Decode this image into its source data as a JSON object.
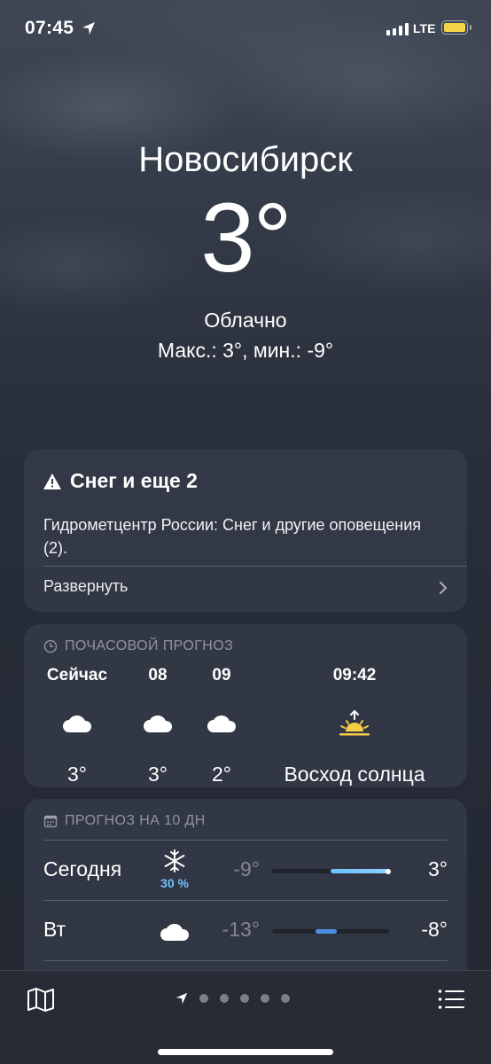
{
  "status_bar": {
    "time": "07:45",
    "network": "LTE",
    "battery_color": "#f5d547"
  },
  "header": {
    "city": "Новосибирск",
    "temperature": "3°",
    "condition": "Облачно",
    "minmax": "Макс.: 3°, мин.: -9°"
  },
  "alert": {
    "title": "Снег и еще 2",
    "body": "Гидрометцентр России: Снег и другие оповещения (2).",
    "expand_label": "Развернуть",
    "icon": "warning-triangle-icon"
  },
  "hourly": {
    "section_label": "ПОЧАСОВОЙ ПРОГНОЗ",
    "items": [
      {
        "time": "Сейчас",
        "icon": "cloud-icon",
        "temp": "3°"
      },
      {
        "time": "08",
        "icon": "cloud-icon",
        "temp": "3°"
      },
      {
        "time": "09",
        "icon": "cloud-icon",
        "temp": "2°"
      },
      {
        "time": "09:42",
        "icon": "sunrise-icon",
        "temp": "Восход солнца"
      }
    ]
  },
  "daily": {
    "section_label": "ПРОГНОЗ НА 10 ДН",
    "days": [
      {
        "day": "Сегодня",
        "icon": "snowflake-icon",
        "precip": "30 %",
        "low": "-9°",
        "high": "3°",
        "range_start_fraction": 0.5,
        "range_end_fraction": 1.0,
        "current_fraction": 0.99
      },
      {
        "day": "Вт",
        "icon": "cloud-icon",
        "precip": "",
        "low": "-13°",
        "high": "-8°",
        "range_start_fraction": 0.37,
        "range_end_fraction": 0.55
      }
    ]
  },
  "bottom_bar": {
    "page_count": 5,
    "accent": "#6ec4ff"
  }
}
